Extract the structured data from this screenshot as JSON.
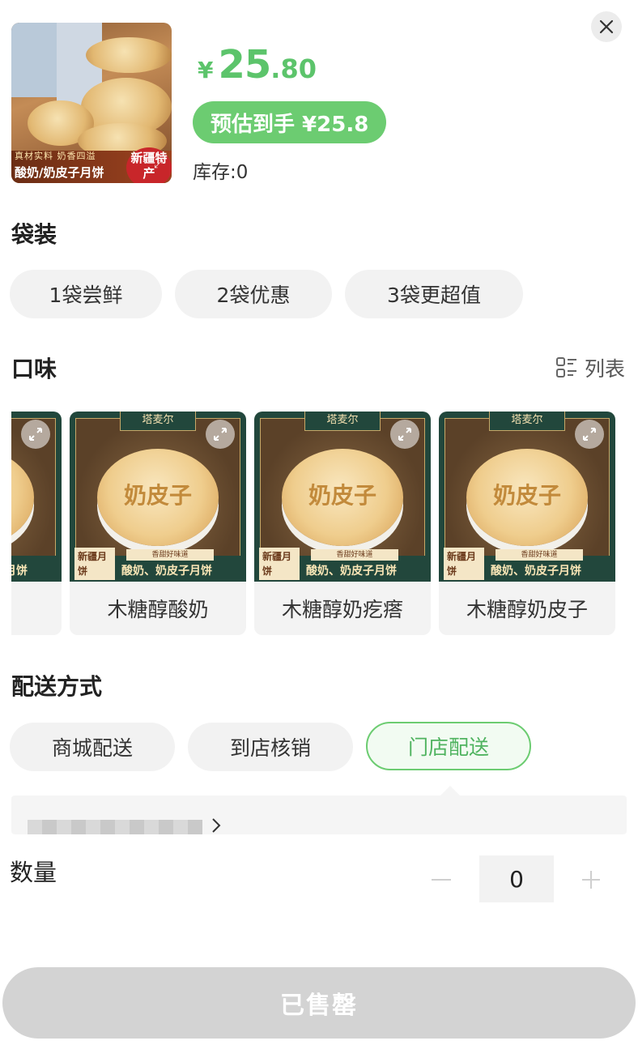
{
  "header": {
    "product_image_tagline": "真材实料 奶香四溢",
    "product_image_title": "酸奶/奶皮子月饼",
    "product_image_badge": "新疆特产",
    "price_symbol": "¥",
    "price_integer": "25",
    "price_decimal": ".80",
    "estimate_label": "预估到手 ¥25.8",
    "stock_label": "库存:0"
  },
  "packaging": {
    "title": "袋装",
    "options": [
      "1袋尝鲜",
      "2袋优惠",
      "3袋更超值"
    ]
  },
  "flavor": {
    "title": "口味",
    "list_toggle_label": "列表",
    "card_image": {
      "brand": "塔麦尔",
      "mooncake_text": "奶皮子",
      "banner_left": "新疆月饼",
      "banner_sub": "香甜好味道",
      "banner_right": "酸奶、奶皮子月饼"
    },
    "items": [
      {
        "name": "木糖醇酸奶"
      },
      {
        "name": "木糖醇奶疙瘩"
      },
      {
        "name": "木糖醇奶皮子"
      }
    ]
  },
  "delivery": {
    "title": "配送方式",
    "options": [
      "商城配送",
      "到店核销",
      "门店配送"
    ],
    "selected": "门店配送"
  },
  "quantity": {
    "label": "数量",
    "value": "0"
  },
  "footer": {
    "button_label": "已售罄"
  },
  "colors": {
    "accent_green": "#6ccc71",
    "price_green": "#5cc46b",
    "disabled_gray": "#d3d3d3"
  }
}
